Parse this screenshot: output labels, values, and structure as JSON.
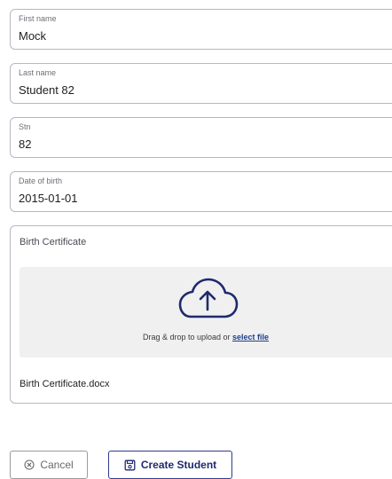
{
  "form": {
    "fields": [
      {
        "label": "First name",
        "value": "Mock"
      },
      {
        "label": "Last name",
        "value": "Student 82"
      },
      {
        "label": "Stn",
        "value": "82"
      },
      {
        "label": "Date of birth",
        "value": "2015-01-01"
      }
    ],
    "upload": {
      "title": "Birth Certificate",
      "drop_text": "Drag & drop to upload or ",
      "select_link": "select file",
      "file_name": "Birth Certificate.docx",
      "icon": "cloud-upload-icon"
    }
  },
  "actions": {
    "cancel_label": "Cancel",
    "cancel_icon": "circle-x-icon",
    "create_label": "Create Student",
    "create_icon": "save-icon"
  },
  "colors": {
    "field_border": "#b8b6c6",
    "dropzone_bg": "#f0f0f0",
    "primary": "#2f3a8f",
    "link": "#1f3d8a"
  }
}
